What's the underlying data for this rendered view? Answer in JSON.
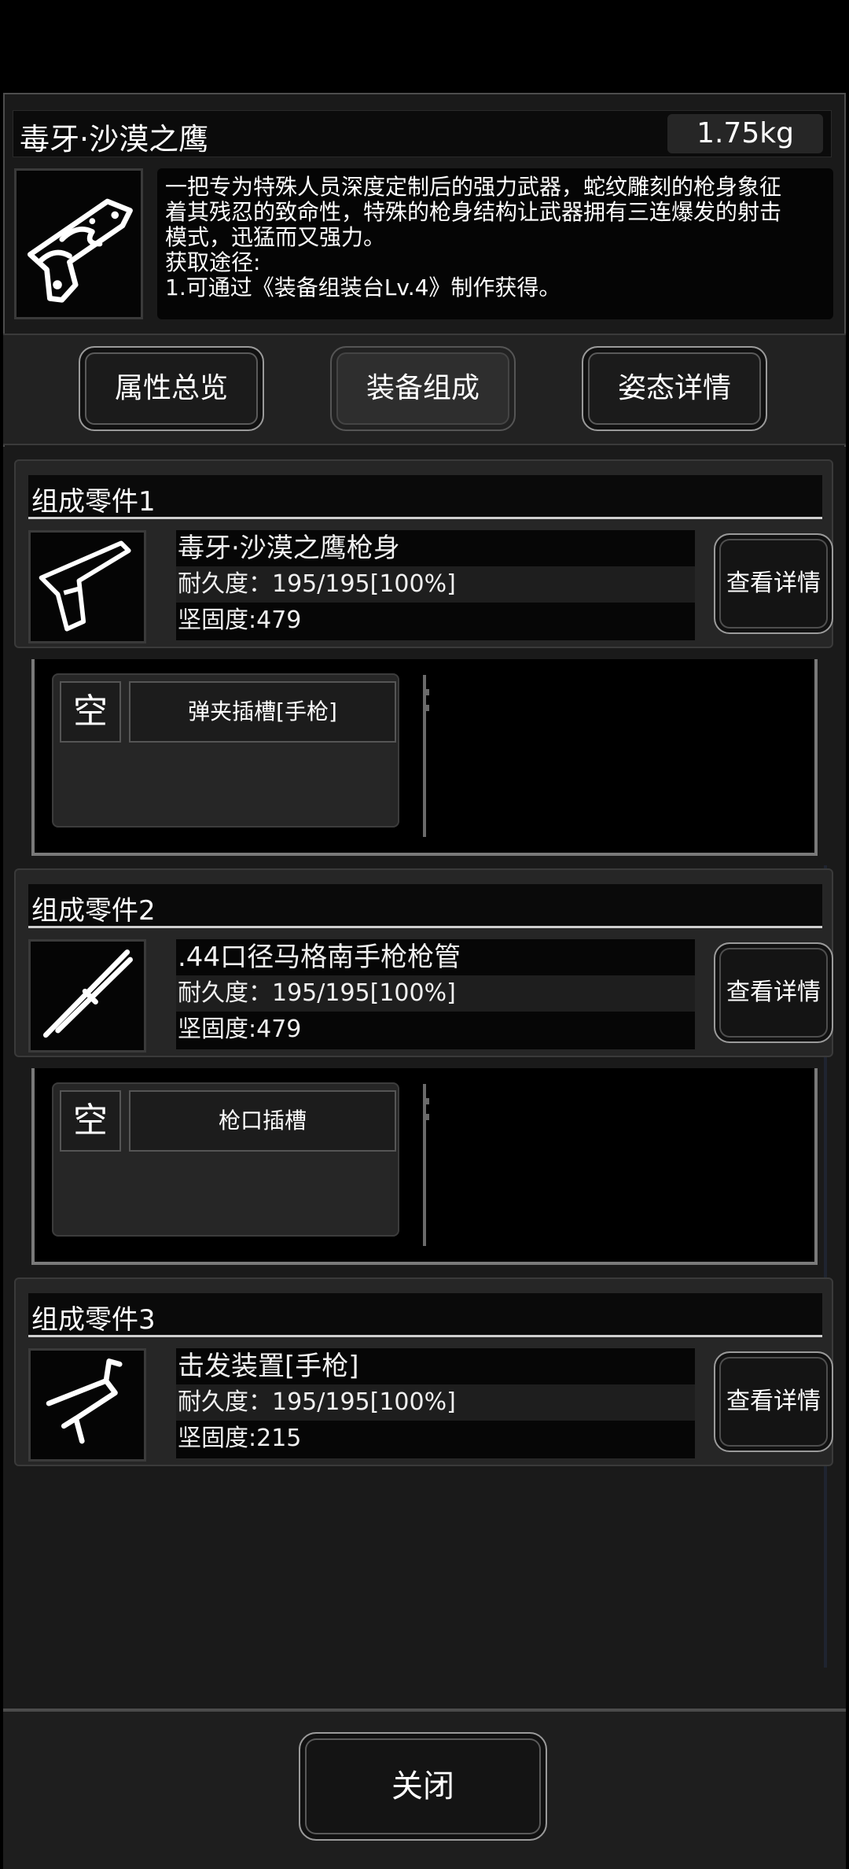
{
  "item": {
    "title": "毒牙·沙漠之鹰",
    "weight": "1.75kg",
    "icon": "pistol-snake-icon",
    "description_lines": [
      "一把专为特殊人员深度定制后的强力武器，蛇纹雕刻的枪身象征",
      "着其残忍的致命性，特殊的枪身结构让武器拥有三连爆发的射击",
      "模式，迅猛而又强力。",
      "获取途径:",
      "1.可通过《装备组装台Lv.4》制作获得。"
    ]
  },
  "tabs": [
    {
      "label": "属性总览",
      "active": false
    },
    {
      "label": "装备组成",
      "active": true
    },
    {
      "label": "姿态详情",
      "active": false
    }
  ],
  "parts": [
    {
      "header": "组成零件1",
      "name": "毒牙·沙漠之鹰枪身",
      "durability": "耐久度：195/195[100%]",
      "hardness": "坚固度:479",
      "detail_label": "查看详情",
      "icon": "pistol-body-icon",
      "slot": {
        "empty_label": "空",
        "label": "弹夹插槽[手枪]"
      }
    },
    {
      "header": "组成零件2",
      "name": ".44口径马格南手枪枪管",
      "durability": "耐久度：195/195[100%]",
      "hardness": "坚固度:479",
      "detail_label": "查看详情",
      "icon": "barrel-icon",
      "slot": {
        "empty_label": "空",
        "label": "枪口插槽"
      }
    },
    {
      "header": "组成零件3",
      "name": "击发装置[手枪]",
      "durability": "耐久度：195/195[100%]",
      "hardness": "坚固度:215",
      "detail_label": "查看详情",
      "icon": "trigger-mechanism-icon"
    }
  ],
  "footer": {
    "close_label": "关闭"
  }
}
